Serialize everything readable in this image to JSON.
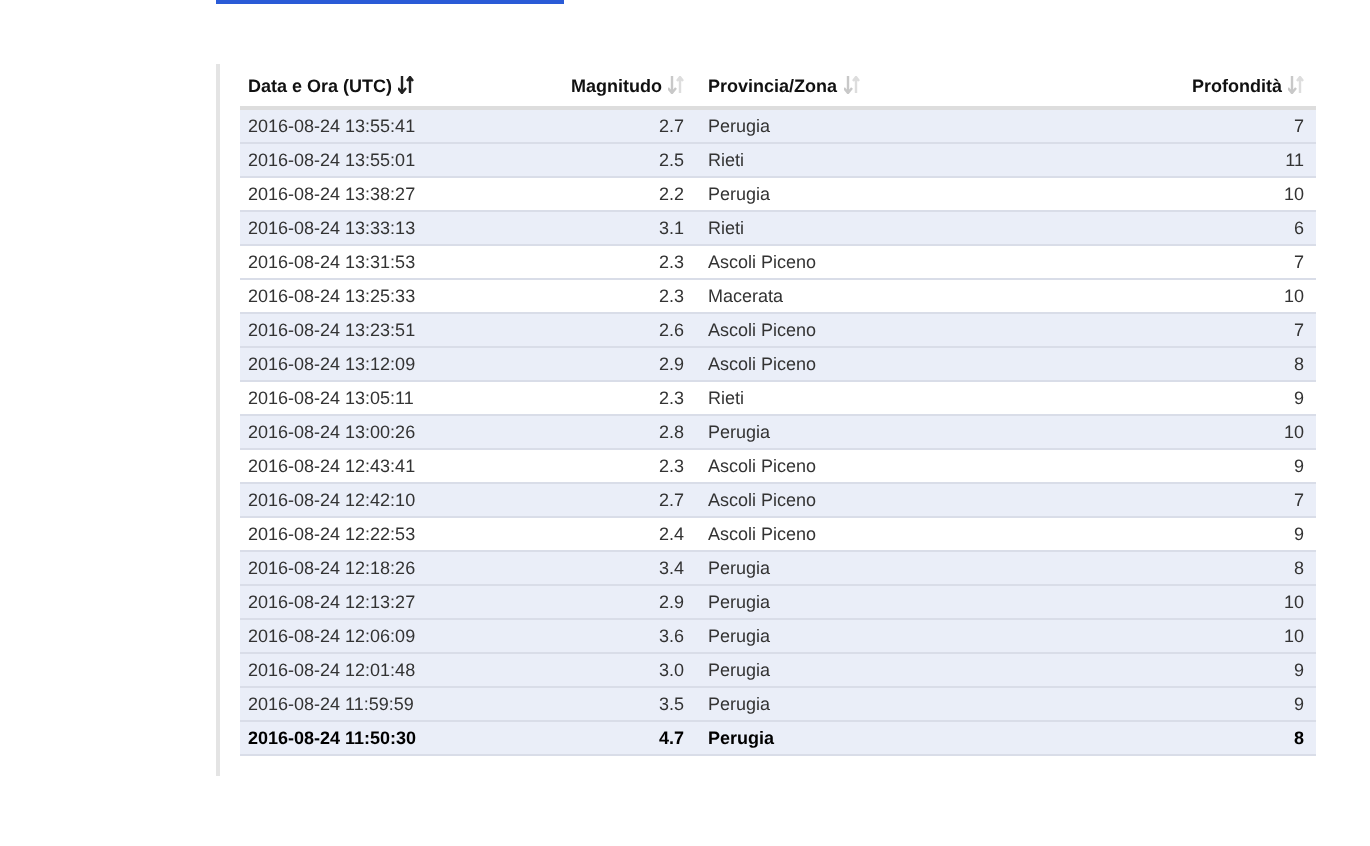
{
  "table": {
    "columns": [
      {
        "label": "Data e Ora (UTC)",
        "sorted": true,
        "kind": "text"
      },
      {
        "label": "Magnitudo",
        "sorted": false,
        "kind": "number"
      },
      {
        "label": "Provincia/Zona",
        "sorted": false,
        "kind": "text"
      },
      {
        "label": "Profondità",
        "sorted": false,
        "kind": "number"
      }
    ],
    "rows": [
      {
        "cells": [
          "2016-08-24 13:55:41",
          "2.7",
          "Perugia",
          "7"
        ],
        "shaded": true,
        "bold": false
      },
      {
        "cells": [
          "2016-08-24 13:55:01",
          "2.5",
          "Rieti",
          "11"
        ],
        "shaded": true,
        "bold": false
      },
      {
        "cells": [
          "2016-08-24 13:38:27",
          "2.2",
          "Perugia",
          "10"
        ],
        "shaded": false,
        "bold": false
      },
      {
        "cells": [
          "2016-08-24 13:33:13",
          "3.1",
          "Rieti",
          "6"
        ],
        "shaded": true,
        "bold": false
      },
      {
        "cells": [
          "2016-08-24 13:31:53",
          "2.3",
          "Ascoli Piceno",
          "7"
        ],
        "shaded": false,
        "bold": false
      },
      {
        "cells": [
          "2016-08-24 13:25:33",
          "2.3",
          "Macerata",
          "10"
        ],
        "shaded": false,
        "bold": false
      },
      {
        "cells": [
          "2016-08-24 13:23:51",
          "2.6",
          "Ascoli Piceno",
          "7"
        ],
        "shaded": true,
        "bold": false
      },
      {
        "cells": [
          "2016-08-24 13:12:09",
          "2.9",
          "Ascoli Piceno",
          "8"
        ],
        "shaded": true,
        "bold": false
      },
      {
        "cells": [
          "2016-08-24 13:05:11",
          "2.3",
          "Rieti",
          "9"
        ],
        "shaded": false,
        "bold": false
      },
      {
        "cells": [
          "2016-08-24 13:00:26",
          "2.8",
          "Perugia",
          "10"
        ],
        "shaded": true,
        "bold": false
      },
      {
        "cells": [
          "2016-08-24 12:43:41",
          "2.3",
          "Ascoli Piceno",
          "9"
        ],
        "shaded": false,
        "bold": false
      },
      {
        "cells": [
          "2016-08-24 12:42:10",
          "2.7",
          "Ascoli Piceno",
          "7"
        ],
        "shaded": true,
        "bold": false
      },
      {
        "cells": [
          "2016-08-24 12:22:53",
          "2.4",
          "Ascoli Piceno",
          "9"
        ],
        "shaded": false,
        "bold": false
      },
      {
        "cells": [
          "2016-08-24 12:18:26",
          "3.4",
          "Perugia",
          "8"
        ],
        "shaded": true,
        "bold": false
      },
      {
        "cells": [
          "2016-08-24 12:13:27",
          "2.9",
          "Perugia",
          "10"
        ],
        "shaded": true,
        "bold": false
      },
      {
        "cells": [
          "2016-08-24 12:06:09",
          "3.6",
          "Perugia",
          "10"
        ],
        "shaded": true,
        "bold": false
      },
      {
        "cells": [
          "2016-08-24 12:01:48",
          "3.0",
          "Perugia",
          "9"
        ],
        "shaded": true,
        "bold": false
      },
      {
        "cells": [
          "2016-08-24 11:59:59",
          "3.5",
          "Perugia",
          "9"
        ],
        "shaded": true,
        "bold": false
      },
      {
        "cells": [
          "2016-08-24 11:50:30",
          "4.7",
          "Perugia",
          "8"
        ],
        "shaded": true,
        "bold": true
      }
    ]
  }
}
